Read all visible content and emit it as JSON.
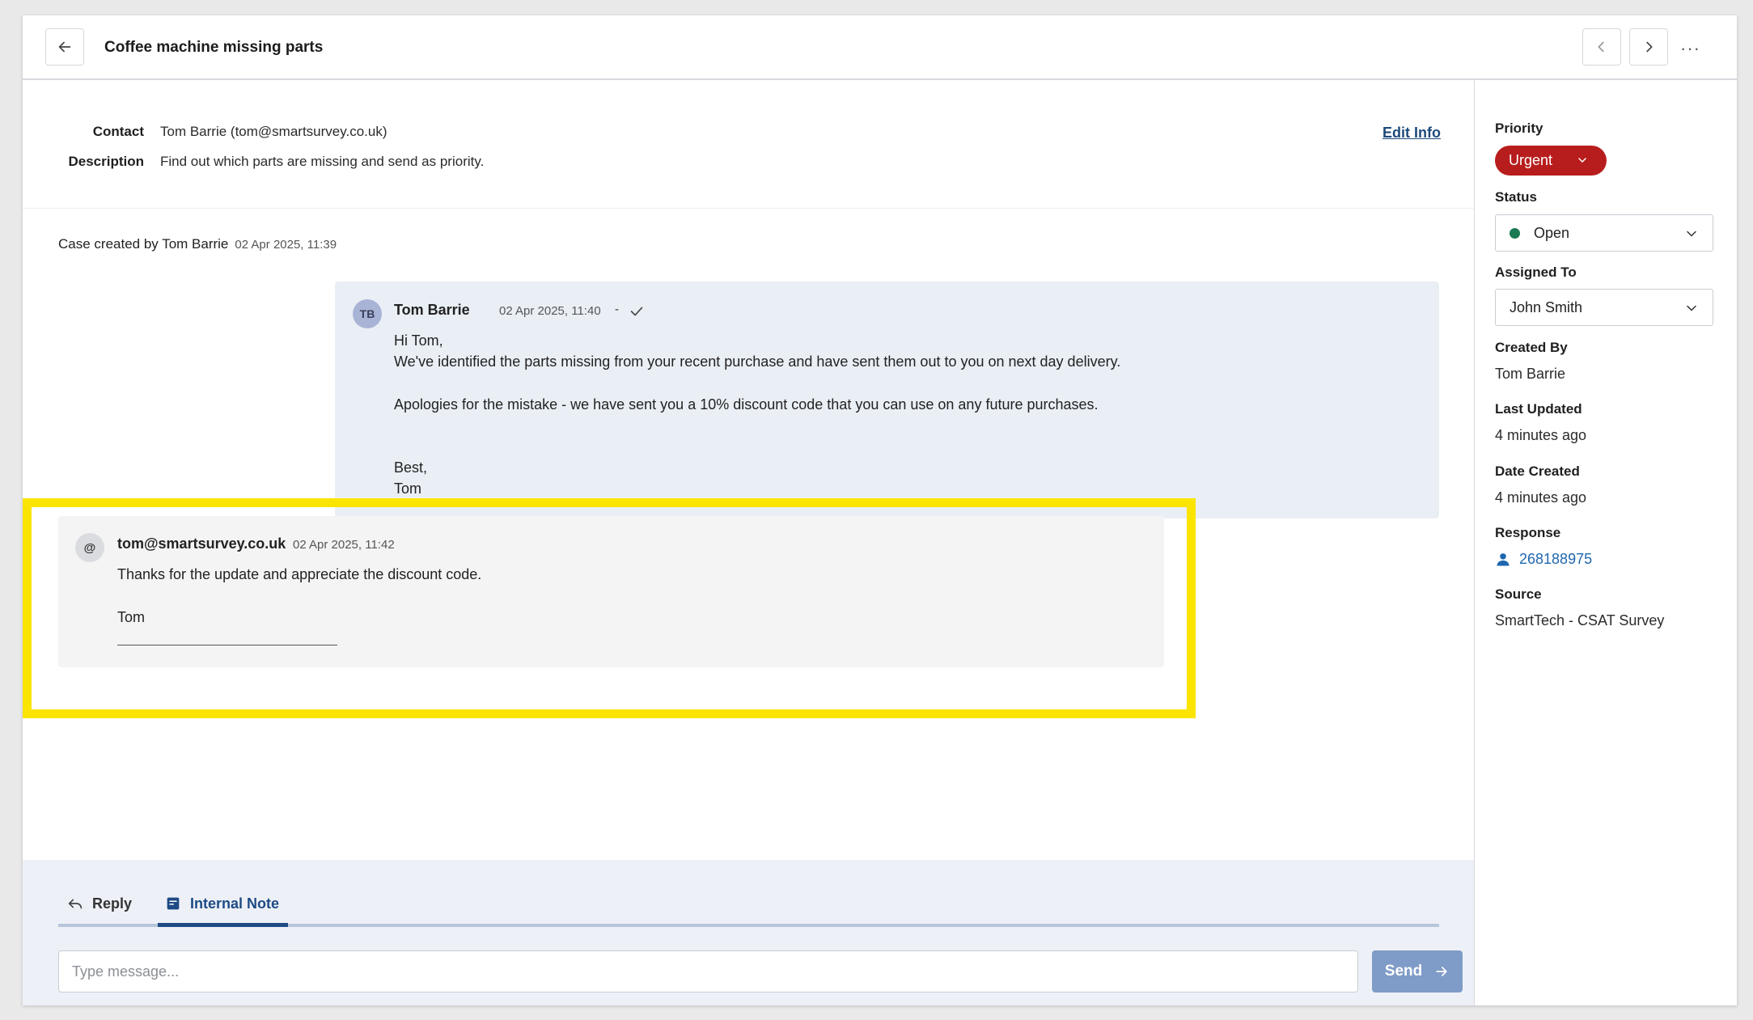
{
  "header": {
    "title": "Coffee machine missing parts",
    "more_label": "···"
  },
  "info": {
    "contact_label": "Contact",
    "contact_value": "Tom Barrie (tom@smartsurvey.co.uk)",
    "description_label": "Description",
    "description_value": "Find out which parts are missing and send as priority.",
    "edit_label": "Edit Info"
  },
  "timeline": {
    "created_text": "Case created by Tom Barrie",
    "created_ts": "02 Apr 2025, 11:39",
    "message1": {
      "initials": "TB",
      "author": "Tom Barrie",
      "timestamp": "02 Apr 2025, 11:40",
      "separator": "-",
      "lines": [
        "Hi Tom,",
        "We've identified the parts missing from your recent purchase and have sent them out to you on next day delivery.",
        "Apologies for the mistake - we have sent you a 10% discount code that you can use on any future purchases.",
        "Best,",
        "Tom"
      ]
    },
    "message2": {
      "initials": "@",
      "author": "tom@smartsurvey.co.uk",
      "timestamp": "02 Apr 2025, 11:42",
      "lines": [
        "Thanks for the update and appreciate the discount code.",
        "Tom"
      ]
    }
  },
  "compose": {
    "tabs": [
      {
        "label": "Reply",
        "active": false
      },
      {
        "label": "Internal Note",
        "active": true
      }
    ],
    "placeholder": "Type message...",
    "send_label": "Send"
  },
  "sidebar": {
    "priority_label": "Priority",
    "priority_value": "Urgent",
    "status_label": "Status",
    "status_value": "Open",
    "assigned_label": "Assigned To",
    "assigned_value": "John Smith",
    "created_by_label": "Created By",
    "created_by_value": "Tom Barrie",
    "last_updated_label": "Last Updated",
    "last_updated_value": "4 minutes ago",
    "date_created_label": "Date Created",
    "date_created_value": "4 minutes ago",
    "response_label": "Response",
    "response_value": "268188975",
    "source_label": "Source",
    "source_value": "SmartTech - CSAT Survey"
  },
  "colors": {
    "accent": "#1e4a85",
    "urgent": "#b81d1d",
    "status_open": "#1a7a52",
    "highlight": "#fbe400",
    "send_button": "#7f9bc7"
  }
}
